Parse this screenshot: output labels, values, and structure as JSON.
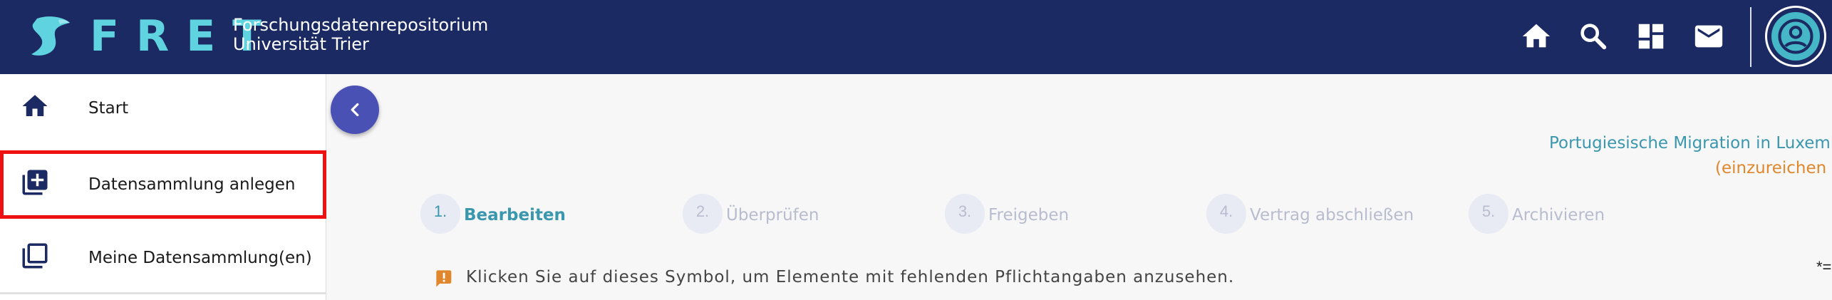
{
  "header": {
    "logo_text": "FRET",
    "subtitle_line1": "Forschungsdatenrepositorium",
    "subtitle_line2": "Universität Trier",
    "icons": [
      "home-icon",
      "search-icon",
      "dashboard-icon",
      "mail-icon",
      "user-avatar-icon"
    ]
  },
  "sidebar": {
    "items": [
      {
        "label": "Start",
        "icon": "home-icon"
      },
      {
        "label": "Datensammlung anlegen",
        "icon": "add-box-icon"
      },
      {
        "label": "Meine Datensammlung(en)",
        "icon": "library-icon"
      }
    ],
    "highlight_color": "#ee1111"
  },
  "main": {
    "title": "Portugiesische Migration in Luxembu",
    "subtitle": "(einzureichen b",
    "steps": [
      {
        "num": "1.",
        "label": "Bearbeiten"
      },
      {
        "num": "2.",
        "label": "Überprüfen"
      },
      {
        "num": "3.",
        "label": "Freigeben"
      },
      {
        "num": "4.",
        "label": "Vertrag abschließen"
      },
      {
        "num": "5.",
        "label": "Archivieren"
      }
    ],
    "hint": "Klicken Sie auf dieses Symbol, um Elemente mit fehlenden Pflichtangaben anzusehen.",
    "required_note": "*="
  },
  "colors": {
    "header_bg": "#1b2a62",
    "accent_cyan": "#5fd4e0",
    "teal_text": "#3a97ae",
    "orange_text": "#e0872d",
    "collapse_button": "#4a51b5"
  }
}
